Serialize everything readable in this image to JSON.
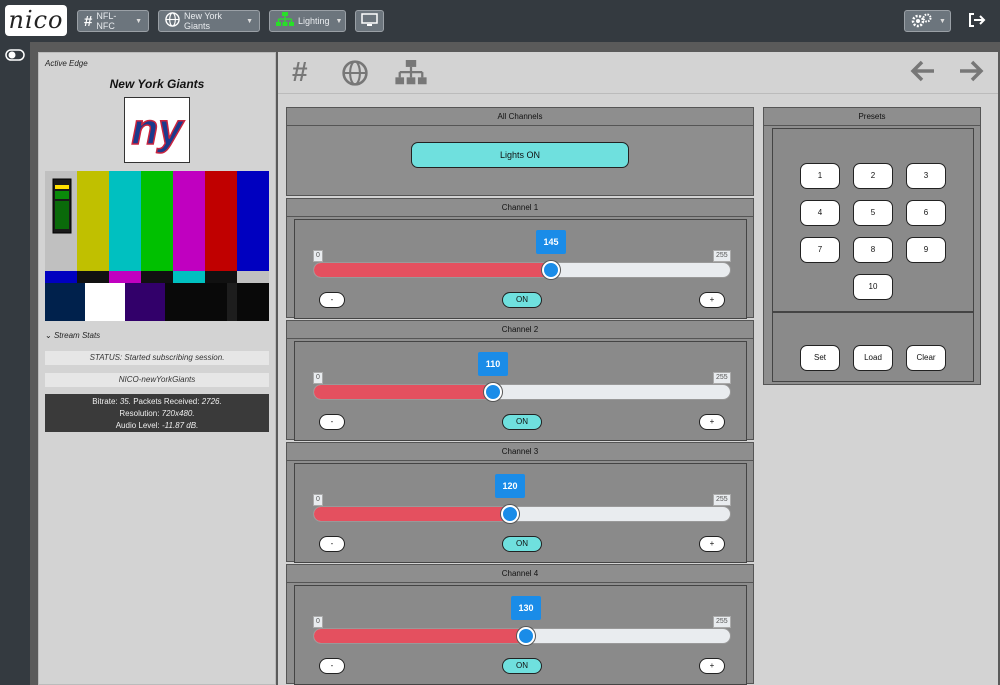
{
  "app": {
    "logo": "nico"
  },
  "topbar": {
    "btn_nfl": "NFL-NFC",
    "btn_team": "New York Giants",
    "btn_lighting": "Lighting"
  },
  "left": {
    "active_edge": "Active Edge",
    "team_name": "New York Giants",
    "stats_title": "Stream Stats",
    "status": "STATUS: Started subscribing session.",
    "stream_name": "NICO-newYorkGiants",
    "bitrate_label": "Bitrate: ",
    "bitrate_value": "35.",
    "packets_label": "Packets Received: ",
    "packets_value": "2726.",
    "resolution_label": "Resolution: ",
    "resolution_value": "720x480.",
    "audio_label": "Audio Level: ",
    "audio_value": "-11.87 dB."
  },
  "all_channels": {
    "title": "All Channels",
    "lights_on": "Lights ON"
  },
  "channels": [
    {
      "title": "Channel 1",
      "value": "145",
      "level": 145,
      "min": "0",
      "max": "255",
      "minus": "-",
      "on": "ON",
      "plus": "+"
    },
    {
      "title": "Channel 2",
      "value": "110",
      "level": 110,
      "min": "0",
      "max": "255",
      "minus": "-",
      "on": "ON",
      "plus": "+"
    },
    {
      "title": "Channel 3",
      "value": "120",
      "level": 120,
      "min": "0",
      "max": "255",
      "minus": "-",
      "on": "ON",
      "plus": "+"
    },
    {
      "title": "Channel 4",
      "value": "130",
      "level": 130,
      "min": "0",
      "max": "255",
      "minus": "-",
      "on": "ON",
      "plus": "+"
    }
  ],
  "presets": {
    "title": "Presets",
    "numbers": [
      "1",
      "2",
      "3",
      "4",
      "5",
      "6",
      "7",
      "8",
      "9",
      "10"
    ],
    "set": "Set",
    "load": "Load",
    "clear": "Clear"
  },
  "colors": {
    "fill": "#e4505f",
    "thumb": "#1a8ce8",
    "on_button": "#6fe0de",
    "topbar": "#343a40"
  }
}
